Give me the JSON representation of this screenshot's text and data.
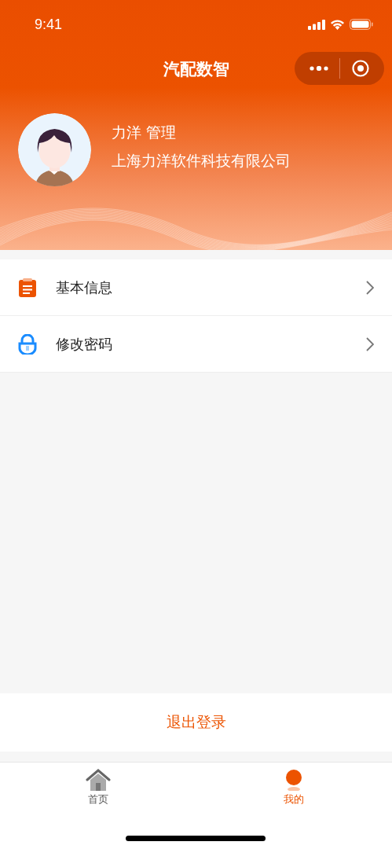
{
  "status_bar": {
    "time": "9:41"
  },
  "nav_bar": {
    "title": "汽配数智"
  },
  "profile": {
    "name": "力洋 管理",
    "company": "上海力洋软件科技有限公司"
  },
  "menu": [
    {
      "label": "基本信息",
      "kind": "info"
    },
    {
      "label": "修改密码",
      "kind": "password"
    }
  ],
  "logout_button": "退出登录",
  "tab_bar": [
    {
      "label": "首页",
      "kind": "home",
      "selected": false
    },
    {
      "label": "我的",
      "kind": "me",
      "selected": true
    }
  ]
}
